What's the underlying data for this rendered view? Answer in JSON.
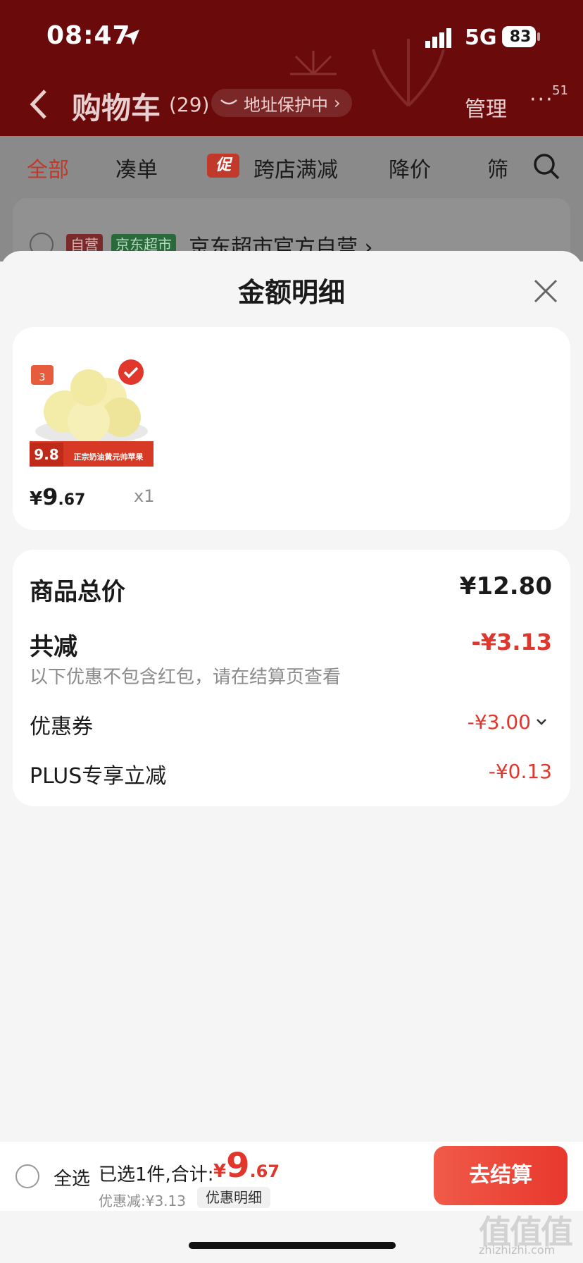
{
  "status": {
    "time": "08:47",
    "network": "5G",
    "battery": "83"
  },
  "nav": {
    "title": "购物车",
    "count": "(29)",
    "address_pill": "地址保护中",
    "manage": "管理",
    "more": "···",
    "more_badge": "51"
  },
  "filter_tabs": [
    "全部",
    "凑单",
    "跨店满减",
    "降价",
    "筛"
  ],
  "promo_tag": "促",
  "store": {
    "tag1": "自营",
    "tag2": "京东超市",
    "name": "京东超市官方自营 ›"
  },
  "sheet": {
    "title": "金额明细",
    "product": {
      "price_yen": "¥",
      "price_int": "9",
      "price_dec": ".67",
      "qty": "x1",
      "thumb_price": "9.8",
      "thumb_caption": "正宗奶油黄元帅苹果",
      "thumb_badge": "3"
    },
    "summary": {
      "total_label": "商品总价",
      "total_value": "¥12.80",
      "discount_label": "共减",
      "discount_value": "-¥3.13",
      "note": "以下优惠不包含红包，请在结算页查看",
      "coupon_label": "优惠券",
      "coupon_value": "-¥3.00",
      "plus_label": "PLUS专享立减",
      "plus_value": "-¥0.13"
    }
  },
  "checkout": {
    "select_all": "全选",
    "selected_text": "已选1件,合计:",
    "total_yen": "¥",
    "total_int": "9",
    "total_dec": ".67",
    "discount_text": "优惠减:¥3.13",
    "detail_chip": "优惠明细",
    "button": "去结算"
  },
  "watermark": {
    "main": "值值值",
    "sub": "zhizhizhi.com"
  },
  "colors": {
    "accent_red": "#e0362c",
    "header_dark_red": "#6a0a0a"
  }
}
